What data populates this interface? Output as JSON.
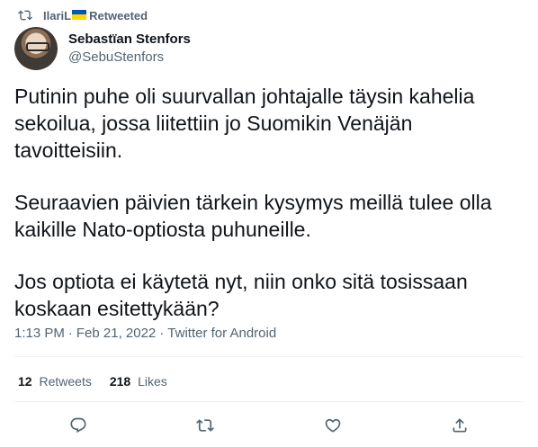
{
  "retweet": {
    "user": "IlariL",
    "label": "Retweeted",
    "flag_colors": [
      "#0057b7",
      "#ffd700"
    ]
  },
  "author": {
    "display_name": "Sebastïan Stenfors",
    "handle": "@SebuStenfors"
  },
  "tweet": {
    "paragraphs": [
      "Putinin puhe oli suurvallan johtajalle täysin kahelia sekoilua, jossa liitettiin jo Suomikin Venäjän tavoitteisiin.",
      "Seuraavien päivien tärkein kysymys meillä tulee olla kaikille Nato-optiosta puhuneille.",
      "Jos optiota ei käytetä nyt, niin onko sitä tosissaan koskaan esitettykään?"
    ],
    "time": "1:13 PM",
    "date": "Feb 21, 2022",
    "source": "Twitter for Android",
    "separator": "·"
  },
  "stats": {
    "retweets_count": "12",
    "retweets_label": "Retweets",
    "likes_count": "218",
    "likes_label": "Likes"
  },
  "actions": [
    "reply-icon",
    "retweet-icon",
    "like-icon",
    "share-icon"
  ],
  "colors": {
    "text_primary": "#0f1419",
    "text_secondary": "#536471",
    "divider": "#eff3f4"
  }
}
